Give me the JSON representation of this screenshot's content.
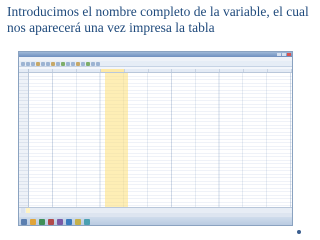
{
  "slide": {
    "title": "Introducimos el nombre completo de la variable, el cual nos aparecerá una vez impresa la tabla"
  },
  "window": {
    "title": "",
    "menu": [
      "",
      "",
      "",
      "",
      "",
      "",
      "",
      "",
      "",
      ""
    ],
    "columns": [
      "",
      "",
      "",
      "",
      "",
      "",
      "",
      "",
      "",
      "",
      ""
    ],
    "active_column_index": 3,
    "tabs": [
      "",
      ""
    ]
  },
  "taskbar": {
    "clock": ""
  },
  "colors": {
    "title": "#1f4a7c",
    "highlight": "#fde9a6"
  }
}
